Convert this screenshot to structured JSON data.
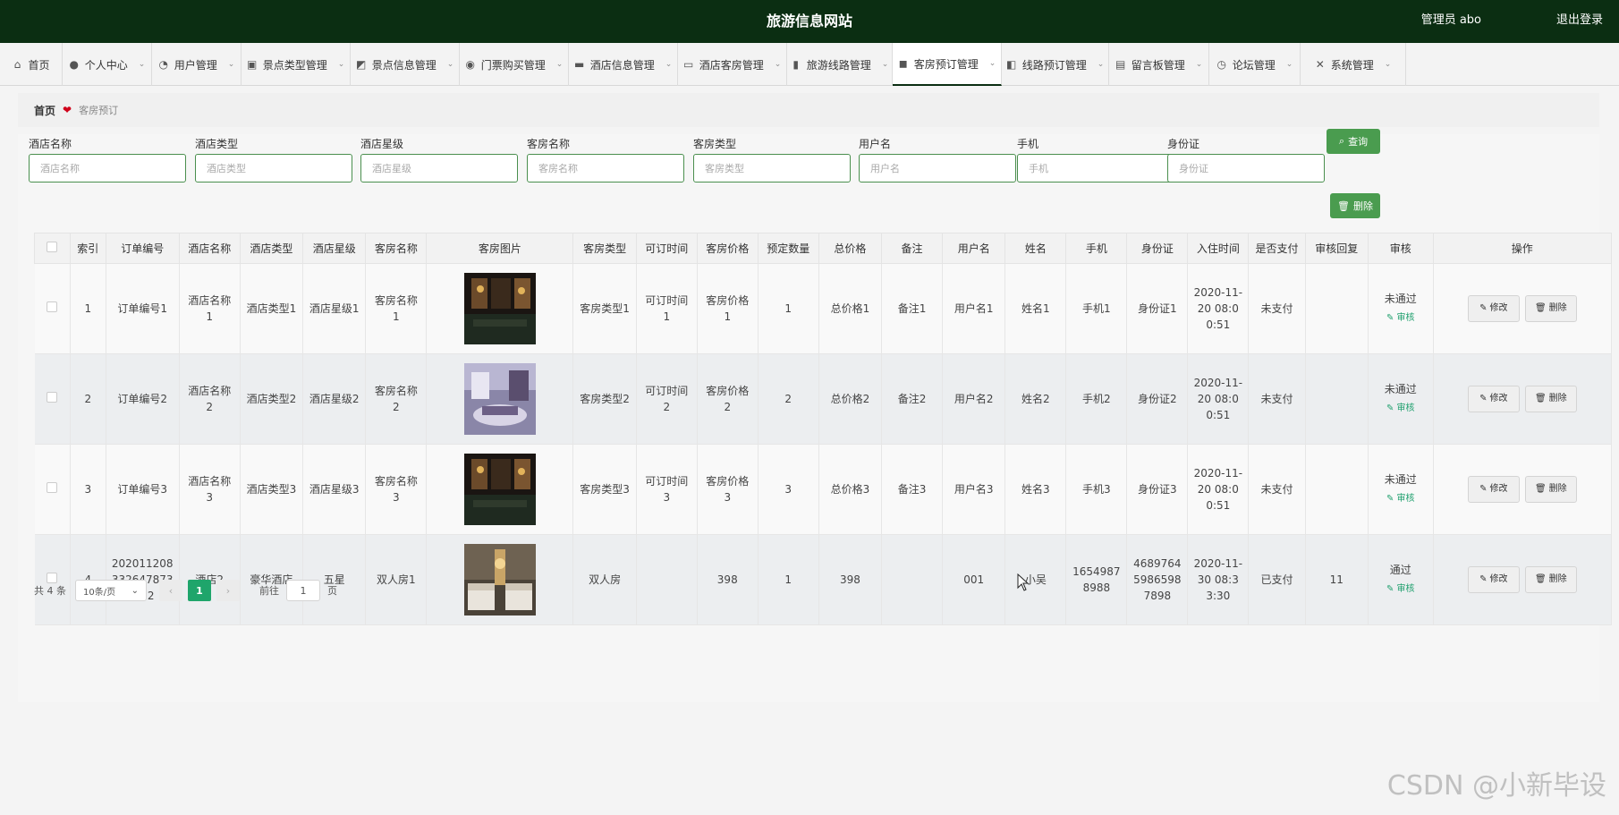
{
  "header": {
    "title": "旅游信息网站",
    "admin": "管理员 abo",
    "logout": "退出登录"
  },
  "nav": [
    {
      "icon": "⌂",
      "label": "首页",
      "chevron": false
    },
    {
      "icon": "●",
      "label": "个人中心",
      "chevron": true
    },
    {
      "icon": "◔",
      "label": "用户管理",
      "chevron": true
    },
    {
      "icon": "▣",
      "label": "景点类型管理",
      "chevron": true
    },
    {
      "icon": "◩",
      "label": "景点信息管理",
      "chevron": true
    },
    {
      "icon": "◉",
      "label": "门票购买管理",
      "chevron": true
    },
    {
      "icon": "▬",
      "label": "酒店信息管理",
      "chevron": true
    },
    {
      "icon": "▭",
      "label": "酒店客房管理",
      "chevron": true
    },
    {
      "icon": "▮",
      "label": "旅游线路管理",
      "chevron": true
    },
    {
      "icon": "◼",
      "label": "客房预订管理",
      "chevron": true,
      "active": true
    },
    {
      "icon": "◧",
      "label": "线路预订管理",
      "chevron": true
    },
    {
      "icon": "▤",
      "label": "留言板管理",
      "chevron": true
    },
    {
      "icon": "◷",
      "label": "论坛管理",
      "chevron": true
    },
    {
      "icon": "✕",
      "label": "系统管理",
      "chevron": true
    }
  ],
  "breadcrumb": {
    "home": "首页",
    "current": "客房预订"
  },
  "search": {
    "fields": [
      {
        "label": "酒店名称",
        "placeholder": "酒店名称"
      },
      {
        "label": "酒店类型",
        "placeholder": "酒店类型"
      },
      {
        "label": "酒店星级",
        "placeholder": "酒店星级"
      },
      {
        "label": "客房名称",
        "placeholder": "客房名称"
      },
      {
        "label": "客房类型",
        "placeholder": "客房类型"
      },
      {
        "label": "用户名",
        "placeholder": "用户名"
      },
      {
        "label": "手机",
        "placeholder": "手机"
      },
      {
        "label": "身份证",
        "placeholder": "身份证"
      }
    ],
    "query_label": "查询",
    "delete_label": "删除"
  },
  "table": {
    "columns": [
      "",
      "索引",
      "订单编号",
      "酒店名称",
      "酒店类型",
      "酒店星级",
      "客房名称",
      "客房图片",
      "客房类型",
      "可订时间",
      "客房价格",
      "预定数量",
      "总价格",
      "备注",
      "用户名",
      "姓名",
      "手机",
      "身份证",
      "入住时间",
      "是否支付",
      "审核回复",
      "审核",
      "操作"
    ],
    "rows": [
      {
        "index": "1",
        "order_no": "订单编号1",
        "hotel_name": "酒店名称1",
        "hotel_type": "酒店类型1",
        "hotel_star": "酒店星级1",
        "room_name": "客房名称1",
        "room_type": "客房类型1",
        "available_time": "可订时间1",
        "room_price": "客房价格1",
        "quantity": "1",
        "total_price": "总价格1",
        "remark": "备注1",
        "username": "用户名1",
        "name": "姓名1",
        "phone": "手机1",
        "id_card": "身份证1",
        "checkin": "2020-11-20 08:00:51",
        "paid": "未支付",
        "reply": "",
        "status": "未通过",
        "image": "night"
      },
      {
        "index": "2",
        "order_no": "订单编号2",
        "hotel_name": "酒店名称2",
        "hotel_type": "酒店类型2",
        "hotel_star": "酒店星级2",
        "room_name": "客房名称2",
        "room_type": "客房类型2",
        "available_time": "可订时间2",
        "room_price": "客房价格2",
        "quantity": "2",
        "total_price": "总价格2",
        "remark": "备注2",
        "username": "用户名2",
        "name": "姓名2",
        "phone": "手机2",
        "id_card": "身份证2",
        "checkin": "2020-11-20 08:00:51",
        "paid": "未支付",
        "reply": "",
        "status": "未通过",
        "image": "purple"
      },
      {
        "index": "3",
        "order_no": "订单编号3",
        "hotel_name": "酒店名称3",
        "hotel_type": "酒店类型3",
        "hotel_star": "酒店星级3",
        "room_name": "客房名称3",
        "room_type": "客房类型3",
        "available_time": "可订时间3",
        "room_price": "客房价格3",
        "quantity": "3",
        "total_price": "总价格3",
        "remark": "备注3",
        "username": "用户名3",
        "name": "姓名3",
        "phone": "手机3",
        "id_card": "身份证3",
        "checkin": "2020-11-20 08:00:51",
        "paid": "未支付",
        "reply": "",
        "status": "未通过",
        "image": "night"
      },
      {
        "index": "4",
        "order_no": "20201120833264787349 2",
        "hotel_name": "酒店2",
        "hotel_type": "豪华酒店",
        "hotel_star": "五星",
        "room_name": "双人房1",
        "room_type": "双人房",
        "available_time": "",
        "room_price": "398",
        "quantity": "1",
        "total_price": "398",
        "remark": "",
        "username": "001",
        "name": "小吴",
        "phone": "16549878988",
        "id_card": "46897645986598 7898",
        "checkin": "2020-11-30 08:33:30",
        "paid": "已支付",
        "reply": "11",
        "status": "通过",
        "image": "beds"
      }
    ],
    "audit_label": "审核",
    "edit_label": "修改",
    "delete_label": "删除"
  },
  "pager": {
    "total": "共 4 条",
    "page_size": "10条/页",
    "current": "1",
    "goto_prefix": "前往",
    "goto_value": "1",
    "goto_suffix": "页"
  },
  "watermark": "CSDN @小新毕设",
  "colors": {
    "header": "#0b2e12",
    "accent": "#4a9c4f",
    "pager_active": "#1fa56b"
  }
}
